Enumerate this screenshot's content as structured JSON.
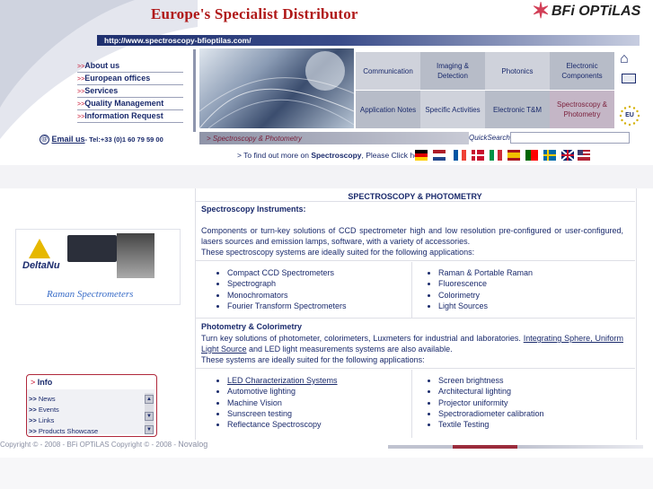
{
  "header": {
    "tagline": "Europe's Specialist Distributor",
    "logo_text": "BFi OPTiLAS",
    "url": "http://www.spectroscopy-bfioptilas.com/"
  },
  "nav": {
    "items": [
      {
        "label": "About us"
      },
      {
        "label": "European offices"
      },
      {
        "label": "Services"
      },
      {
        "label": "Quality Management"
      },
      {
        "label": "Information Request"
      }
    ],
    "arrow": ">>",
    "email_label": "Email us",
    "tel": "- Tel:+33 (0)1 60 79 59 00"
  },
  "menu": {
    "row1": [
      "Communication",
      "Imaging & Detection",
      "Photonics",
      "Electronic Components"
    ],
    "row2": [
      "Application Notes",
      "Specific Activities",
      "Electronic T&M",
      "Spectroscopy & Photometry"
    ]
  },
  "eu_label": "EU",
  "breadcrumb": "> Spectroscopy & Photometry",
  "search": {
    "label": "QuickSearch:",
    "value": ""
  },
  "spectro_prompt": {
    "prefix": "> To find out more on ",
    "bold": "Spectroscopy",
    "suffix": ", Please Click here:"
  },
  "ad": {
    "brand": "DeltaNu",
    "caption": "Raman Spectrometers"
  },
  "info": {
    "title_arrow": ">",
    "title": "Info",
    "items": [
      "News",
      "Events",
      "Links",
      "Products Showcase"
    ],
    "arrow": ">>"
  },
  "content": {
    "title": "SPECTROSCOPY & PHOTOMETRY",
    "s1_head": "Spectroscopy Instruments:",
    "s1_p1": "Components or turn-key solutions of CCD spectrometer high and low resolution pre-configured or user-configured, lasers sources and emission lamps, software, with a variety of accessories.",
    "s1_p2": "These spectroscopy systems are ideally suited for the following applications:",
    "s1_left": [
      "Compact CCD Spectrometers",
      "Spectrograph",
      "Monochromators",
      "Fourier Transform Spectrometers"
    ],
    "s1_right": [
      "Raman & Portable Raman",
      "Fluorescence",
      "Colorimetry",
      "Light Sources"
    ],
    "s2_head": "Photometry & Colorimetry",
    "s2_p1_a": "Turn key solutions of photometer, colorimeters, Luxmeters for industrial and laboratories. ",
    "s2_p1_link": "Integrating Sphere, Uniform Light Source",
    "s2_p1_b": " and LED light measurements systems are also available.",
    "s2_p2": "These systems are ideally suited for the following applications:",
    "s2_left": [
      "LED Characterization Systems",
      "Automotive lighting",
      "Machine Vision",
      "Sunscreen testing",
      "Reflectance Spectroscopy"
    ],
    "s2_right": [
      "Screen brightness",
      "Architectural lighting",
      "Projector uniformity",
      "Spectroradiometer calibration",
      "Textile Testing"
    ]
  },
  "footer": {
    "copy1": "Copyright © - 2008 - BFi OPTiLAS",
    "copy2": " Copyright © - 2008 - ",
    "novalog": "Novalog"
  },
  "colors": {
    "brand_red": "#c8102e",
    "navy": "#1a2a6c",
    "menu_active": "#c4b6c6"
  }
}
